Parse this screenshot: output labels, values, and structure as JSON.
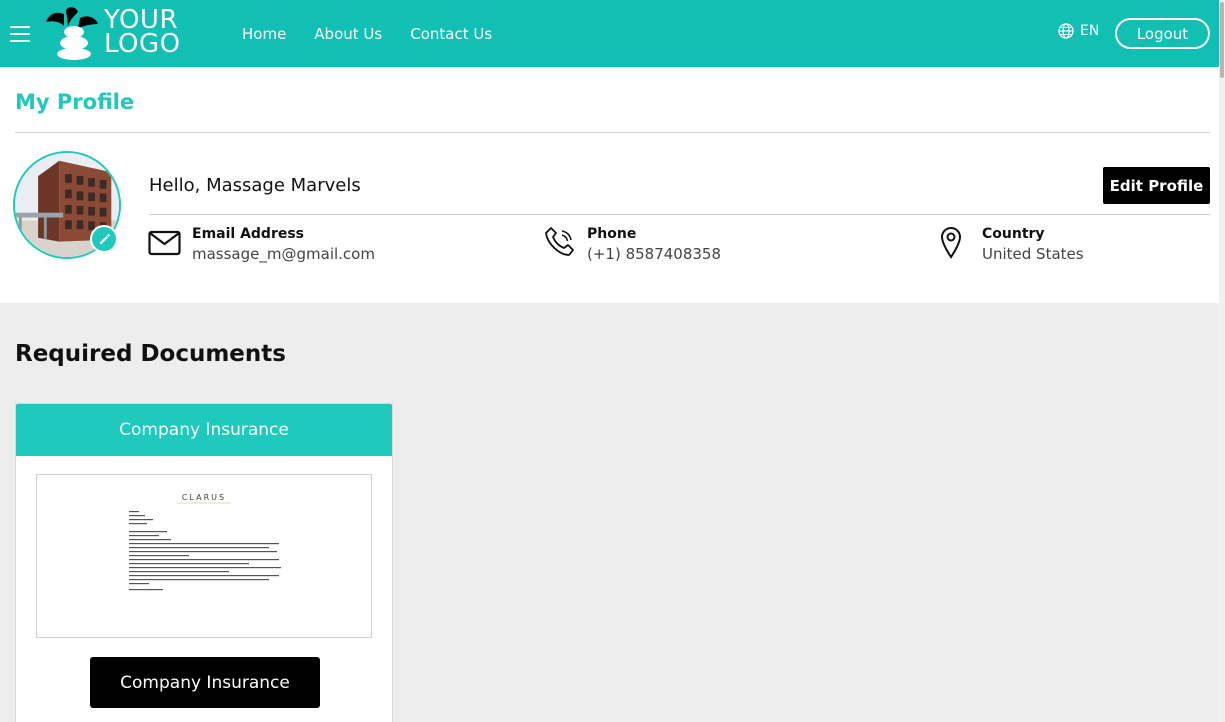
{
  "header": {
    "logo_line1": "YOUR",
    "logo_line2": "LOGO",
    "nav": [
      {
        "label": "Home"
      },
      {
        "label": "About Us"
      },
      {
        "label": "Contact Us"
      }
    ],
    "language": "EN",
    "logout_label": "Logout"
  },
  "profile": {
    "title": "My Profile",
    "greeting": "Hello, Massage Marvels",
    "edit_label": "Edit Profile",
    "email": {
      "label": "Email Address",
      "value": "massage_m@gmail.com"
    },
    "phone": {
      "label": "Phone",
      "value": "(+1) 8587408358"
    },
    "country": {
      "label": "Country",
      "value": "United States"
    }
  },
  "documents": {
    "title": "Required Documents",
    "cards": [
      {
        "header": "Company Insurance",
        "preview_brand": "CLARUS",
        "button_label": "Company Insurance"
      }
    ]
  },
  "colors": {
    "brand": "#11bfb3",
    "accent": "#1fc9bb",
    "button": "#000000"
  }
}
